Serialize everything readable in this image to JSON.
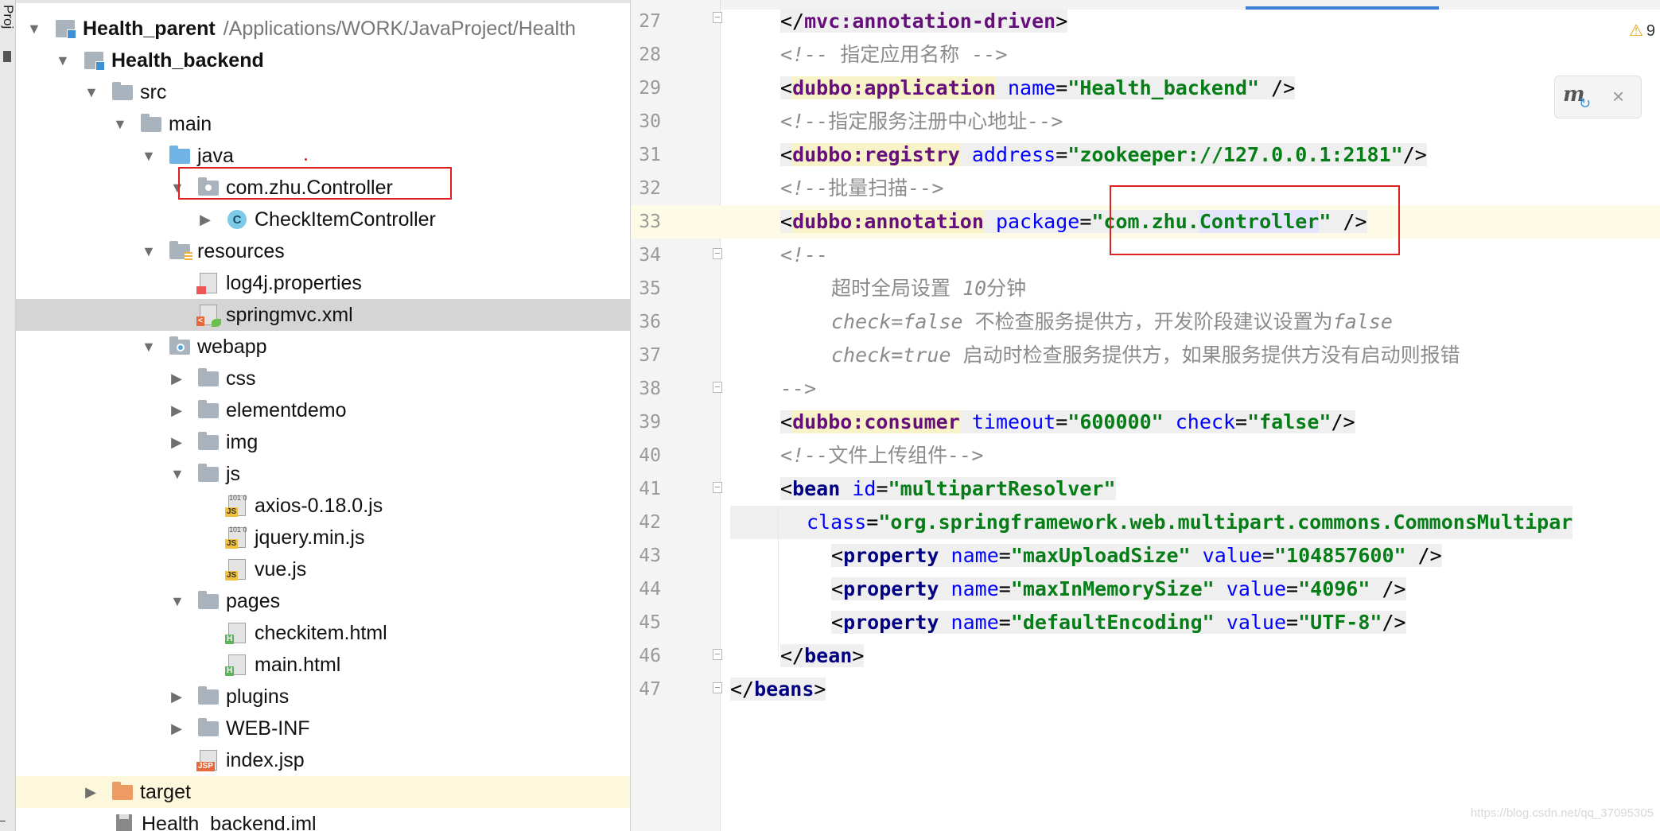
{
  "toolstrip": {
    "tab_label": "Proj",
    "bottom_glyph": "̶"
  },
  "tree": {
    "rows": [
      {
        "id": "health-parent",
        "label": "Health_parent",
        "path": "/Applications/WORK/JavaProject/Health"
      },
      {
        "id": "health-backend",
        "label": "Health_backend"
      },
      {
        "id": "src",
        "label": "src"
      },
      {
        "id": "main",
        "label": "main"
      },
      {
        "id": "java",
        "label": "java"
      },
      {
        "id": "controller-package",
        "label": "com.zhu.Controller"
      },
      {
        "id": "checkitem-controller",
        "label": "CheckItemController",
        "icon_text": "C"
      },
      {
        "id": "resources",
        "label": "resources"
      },
      {
        "id": "log4j",
        "label": "log4j.properties"
      },
      {
        "id": "springmvc",
        "label": "springmvc.xml"
      },
      {
        "id": "webapp",
        "label": "webapp"
      },
      {
        "id": "css",
        "label": "css"
      },
      {
        "id": "elementdemo",
        "label": "elementdemo"
      },
      {
        "id": "img",
        "label": "img"
      },
      {
        "id": "js",
        "label": "js"
      },
      {
        "id": "axios",
        "label": "axios-0.18.0.js",
        "icon_text": "JS",
        "bin_text": "101\n0"
      },
      {
        "id": "jquery",
        "label": "jquery.min.js",
        "icon_text": "JS",
        "bin_text": "101\n0"
      },
      {
        "id": "vue",
        "label": "vue.js",
        "icon_text": "JS"
      },
      {
        "id": "pages",
        "label": "pages"
      },
      {
        "id": "checkitem-html",
        "label": "checkitem.html",
        "icon_text": "H"
      },
      {
        "id": "main-html",
        "label": "main.html",
        "icon_text": "H"
      },
      {
        "id": "plugins",
        "label": "plugins"
      },
      {
        "id": "web-inf",
        "label": "WEB-INF"
      },
      {
        "id": "index-jsp",
        "label": "index.jsp",
        "icon_text": "JSP"
      },
      {
        "id": "target",
        "label": "target"
      },
      {
        "id": "backend-iml",
        "label": "Health_backend.iml"
      }
    ]
  },
  "editor": {
    "warnings": {
      "icon": "warning-icon",
      "count": "9"
    },
    "popup": {
      "icon": "maven-reload-icon",
      "glyph": "m",
      "refresh_glyph": "↻",
      "close_glyph": "×"
    },
    "lines": [
      {
        "n": "27",
        "p": [
          "</",
          "mvc:annotation-driven",
          ">"
        ]
      },
      {
        "n": "28",
        "p": [
          "<!-- ",
          "指定应用名称",
          " -->"
        ]
      },
      {
        "n": "29",
        "p": [
          "<",
          "dubbo:application",
          " ",
          "name",
          "=",
          "\"Health_backend\"",
          " />"
        ]
      },
      {
        "n": "30",
        "p": [
          "<!--",
          "指定服务注册中心地址",
          "-->"
        ]
      },
      {
        "n": "31",
        "p": [
          "<",
          "dubbo:registry",
          " ",
          "address",
          "=",
          "\"zookeeper://127.0.0.1:2181\"",
          "/>"
        ]
      },
      {
        "n": "32",
        "p": [
          "<!--",
          "批量扫描",
          "-->"
        ]
      },
      {
        "n": "33",
        "p": [
          "<",
          "dubbo:annotation",
          " ",
          "package",
          "=",
          "\"com.zhu.",
          "Controller",
          "\"",
          " />"
        ]
      },
      {
        "n": "34",
        "p": [
          "<!--"
        ]
      },
      {
        "n": "35",
        "p": [
          "超时全局设置 ",
          "10",
          "分钟"
        ]
      },
      {
        "n": "36",
        "p": [
          "check=false",
          " 不检查服务提供方，开发阶段建议设置为",
          "false"
        ]
      },
      {
        "n": "37",
        "p": [
          "check=true",
          " 启动时检查服务提供方，如果服务提供方没有启动则报错"
        ]
      },
      {
        "n": "38",
        "p": [
          "-->"
        ]
      },
      {
        "n": "39",
        "p": [
          "<",
          "dubbo:consumer",
          " ",
          "timeout",
          "=",
          "\"600000\"",
          " ",
          "check",
          "=",
          "\"false\"",
          "/>"
        ]
      },
      {
        "n": "40",
        "p": [
          "<!--",
          "文件上传组件",
          "-->"
        ]
      },
      {
        "n": "41",
        "p": [
          "<",
          "bean",
          " ",
          "id",
          "=",
          "\"multipartResolver\""
        ]
      },
      {
        "n": "42",
        "p": [
          "class",
          "=",
          "\"org.springframework.web.multipart.commons.CommonsMultipar"
        ]
      },
      {
        "n": "43",
        "p": [
          "<",
          "property",
          " ",
          "name",
          "=",
          "\"maxUploadSize\"",
          " ",
          "value",
          "=",
          "\"104857600\"",
          " />"
        ]
      },
      {
        "n": "44",
        "p": [
          "<",
          "property",
          " ",
          "name",
          "=",
          "\"maxInMemorySize\"",
          " ",
          "value",
          "=",
          "\"4096\"",
          " />"
        ]
      },
      {
        "n": "45",
        "p": [
          "<",
          "property",
          " ",
          "name",
          "=",
          "\"defaultEncoding\"",
          " ",
          "value",
          "=",
          "\"UTF-8\"",
          "/>"
        ]
      },
      {
        "n": "46",
        "p": [
          "</",
          "bean",
          ">"
        ]
      },
      {
        "n": "47",
        "p": [
          "</",
          "beans",
          ">"
        ]
      }
    ]
  },
  "watermark": "https://blog.csdn.net/qq_37095305"
}
